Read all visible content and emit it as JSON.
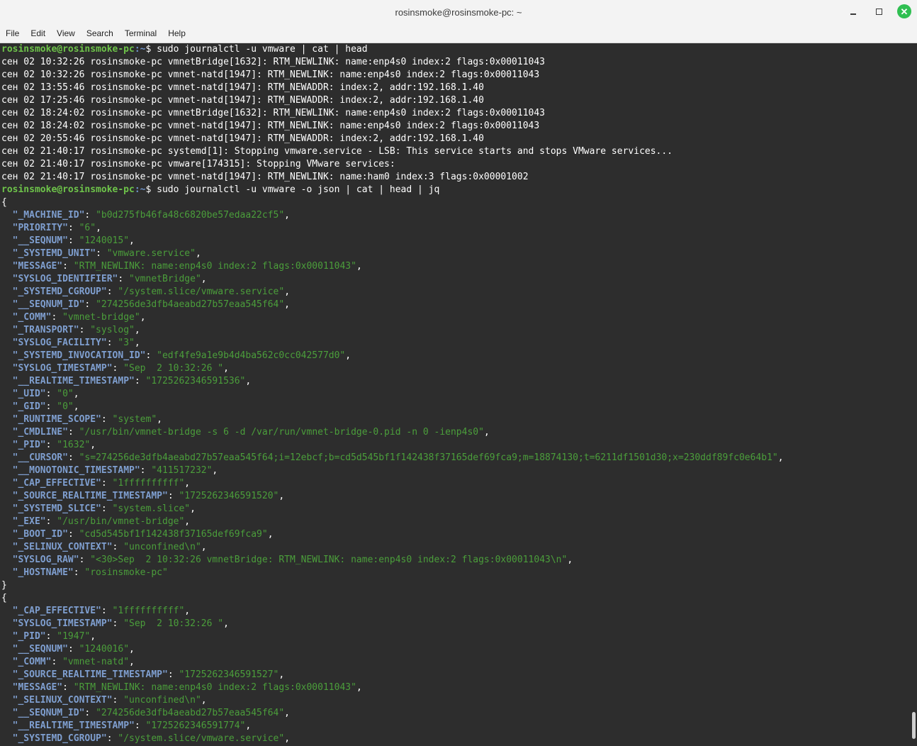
{
  "window": {
    "title": "rosinsmoke@rosinsmoke-pc: ~"
  },
  "menu": [
    "File",
    "Edit",
    "View",
    "Search",
    "Terminal",
    "Help"
  ],
  "prompt": {
    "user_host": "rosinsmoke@rosinsmoke-pc",
    "path": ":~",
    "symbol": "$ "
  },
  "commands": [
    "sudo journalctl -u vmware | cat | head",
    "sudo journalctl -u vmware -o json | cat | head | jq"
  ],
  "log_lines": [
    "сен 02 10:32:26 rosinsmoke-pc vmnetBridge[1632]: RTM_NEWLINK: name:enp4s0 index:2 flags:0x00011043",
    "сен 02 10:32:26 rosinsmoke-pc vmnet-natd[1947]: RTM_NEWLINK: name:enp4s0 index:2 flags:0x00011043",
    "сен 02 13:55:46 rosinsmoke-pc vmnet-natd[1947]: RTM_NEWADDR: index:2, addr:192.168.1.40",
    "сен 02 17:25:46 rosinsmoke-pc vmnet-natd[1947]: RTM_NEWADDR: index:2, addr:192.168.1.40",
    "сен 02 18:24:02 rosinsmoke-pc vmnetBridge[1632]: RTM_NEWLINK: name:enp4s0 index:2 flags:0x00011043",
    "сен 02 18:24:02 rosinsmoke-pc vmnet-natd[1947]: RTM_NEWLINK: name:enp4s0 index:2 flags:0x00011043",
    "сен 02 20:55:46 rosinsmoke-pc vmnet-natd[1947]: RTM_NEWADDR: index:2, addr:192.168.1.40",
    "сен 02 21:40:17 rosinsmoke-pc systemd[1]: Stopping vmware.service - LSB: This service starts and stops VMware services...",
    "сен 02 21:40:17 rosinsmoke-pc vmware[174315]: Stopping VMware services:",
    "сен 02 21:40:17 rosinsmoke-pc vmnet-natd[1947]: RTM_NEWLINK: name:ham0 index:3 flags:0x00001002"
  ],
  "json_objects": [
    {
      "open": "{",
      "close": "}",
      "entries": [
        {
          "key": "\"_MACHINE_ID\"",
          "value": "\"b0d275fb46fa48c6820be57edaa22cf5\"",
          "sep": ","
        },
        {
          "key": "\"PRIORITY\"",
          "value": "\"6\"",
          "sep": ","
        },
        {
          "key": "\"__SEQNUM\"",
          "value": "\"1240015\"",
          "sep": ","
        },
        {
          "key": "\"_SYSTEMD_UNIT\"",
          "value": "\"vmware.service\"",
          "sep": ","
        },
        {
          "key": "\"MESSAGE\"",
          "value": "\"RTM_NEWLINK: name:enp4s0 index:2 flags:0x00011043\"",
          "sep": ","
        },
        {
          "key": "\"SYSLOG_IDENTIFIER\"",
          "value": "\"vmnetBridge\"",
          "sep": ","
        },
        {
          "key": "\"_SYSTEMD_CGROUP\"",
          "value": "\"/system.slice/vmware.service\"",
          "sep": ","
        },
        {
          "key": "\"__SEQNUM_ID\"",
          "value": "\"274256de3dfb4aeabd27b57eaa545f64\"",
          "sep": ","
        },
        {
          "key": "\"_COMM\"",
          "value": "\"vmnet-bridge\"",
          "sep": ","
        },
        {
          "key": "\"_TRANSPORT\"",
          "value": "\"syslog\"",
          "sep": ","
        },
        {
          "key": "\"SYSLOG_FACILITY\"",
          "value": "\"3\"",
          "sep": ","
        },
        {
          "key": "\"_SYSTEMD_INVOCATION_ID\"",
          "value": "\"edf4fe9a1e9b4d4ba562c0cc042577d0\"",
          "sep": ","
        },
        {
          "key": "\"SYSLOG_TIMESTAMP\"",
          "value": "\"Sep  2 10:32:26 \"",
          "sep": ","
        },
        {
          "key": "\"__REALTIME_TIMESTAMP\"",
          "value": "\"1725262346591536\"",
          "sep": ","
        },
        {
          "key": "\"_UID\"",
          "value": "\"0\"",
          "sep": ","
        },
        {
          "key": "\"_GID\"",
          "value": "\"0\"",
          "sep": ","
        },
        {
          "key": "\"_RUNTIME_SCOPE\"",
          "value": "\"system\"",
          "sep": ","
        },
        {
          "key": "\"_CMDLINE\"",
          "value": "\"/usr/bin/vmnet-bridge -s 6 -d /var/run/vmnet-bridge-0.pid -n 0 -ienp4s0\"",
          "sep": ","
        },
        {
          "key": "\"_PID\"",
          "value": "\"1632\"",
          "sep": ","
        },
        {
          "key": "\"__CURSOR\"",
          "value": "\"s=274256de3dfb4aeabd27b57eaa545f64;i=12ebcf;b=cd5d545bf1f142438f37165def69fca9;m=18874130;t=6211df1501d30;x=230ddf89fc0e64b1\"",
          "sep": ","
        },
        {
          "key": "\"__MONOTONIC_TIMESTAMP\"",
          "value": "\"411517232\"",
          "sep": ","
        },
        {
          "key": "\"_CAP_EFFECTIVE\"",
          "value": "\"1ffffffffff\"",
          "sep": ","
        },
        {
          "key": "\"_SOURCE_REALTIME_TIMESTAMP\"",
          "value": "\"1725262346591520\"",
          "sep": ","
        },
        {
          "key": "\"_SYSTEMD_SLICE\"",
          "value": "\"system.slice\"",
          "sep": ","
        },
        {
          "key": "\"_EXE\"",
          "value": "\"/usr/bin/vmnet-bridge\"",
          "sep": ","
        },
        {
          "key": "\"_BOOT_ID\"",
          "value": "\"cd5d545bf1f142438f37165def69fca9\"",
          "sep": ","
        },
        {
          "key": "\"_SELINUX_CONTEXT\"",
          "value": "\"unconfined\\n\"",
          "sep": ","
        },
        {
          "key": "\"SYSLOG_RAW\"",
          "value": "\"<30>Sep  2 10:32:26 vmnetBridge: RTM_NEWLINK: name:enp4s0 index:2 flags:0x00011043\\n\"",
          "sep": ","
        },
        {
          "key": "\"_HOSTNAME\"",
          "value": "\"rosinsmoke-pc\"",
          "sep": ""
        }
      ]
    },
    {
      "open": "{",
      "close": "",
      "entries": [
        {
          "key": "\"_CAP_EFFECTIVE\"",
          "value": "\"1ffffffffff\"",
          "sep": ","
        },
        {
          "key": "\"SYSLOG_TIMESTAMP\"",
          "value": "\"Sep  2 10:32:26 \"",
          "sep": ","
        },
        {
          "key": "\"_PID\"",
          "value": "\"1947\"",
          "sep": ","
        },
        {
          "key": "\"__SEQNUM\"",
          "value": "\"1240016\"",
          "sep": ","
        },
        {
          "key": "\"_COMM\"",
          "value": "\"vmnet-natd\"",
          "sep": ","
        },
        {
          "key": "\"_SOURCE_REALTIME_TIMESTAMP\"",
          "value": "\"1725262346591527\"",
          "sep": ","
        },
        {
          "key": "\"MESSAGE\"",
          "value": "\"RTM_NEWLINK: name:enp4s0 index:2 flags:0x00011043\"",
          "sep": ","
        },
        {
          "key": "\"_SELINUX_CONTEXT\"",
          "value": "\"unconfined\\n\"",
          "sep": ","
        },
        {
          "key": "\"__SEQNUM_ID\"",
          "value": "\"274256de3dfb4aeabd27b57eaa545f64\"",
          "sep": ","
        },
        {
          "key": "\"__REALTIME_TIMESTAMP\"",
          "value": "\"1725262346591774\"",
          "sep": ","
        },
        {
          "key": "\"_SYSTEMD_CGROUP\"",
          "value": "\"/system.slice/vmware.service\"",
          "sep": ","
        }
      ]
    }
  ],
  "colors": {
    "prompt_user": "#6ec44a",
    "prompt_path": "#6f93c8",
    "json_key": "#7f9fd0",
    "json_value": "#4b9e3b",
    "background": "#2d2d2d"
  }
}
